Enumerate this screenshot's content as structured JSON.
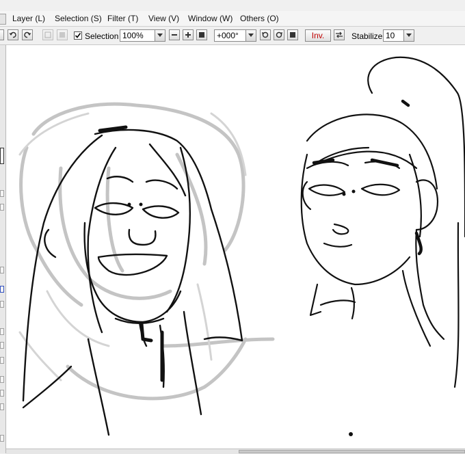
{
  "menu": {
    "items": [
      {
        "label": "Layer (L)"
      },
      {
        "label": "Selection (S)"
      },
      {
        "label": "Filter (T)"
      },
      {
        "label": "View (V)"
      },
      {
        "label": "Window (W)"
      },
      {
        "label": "Others (O)"
      }
    ]
  },
  "toolbar": {
    "undo_icon": "undo-icon",
    "redo_icon": "redo-icon",
    "selection_checkbox_checked": true,
    "selection_label": "Selection",
    "zoom_value": "100%",
    "rotation_value": "+000°",
    "invert_label": "Inv.",
    "stabilizer_label": "Stabilizer",
    "stabilizer_value": "10",
    "invert_color": "#c00000"
  },
  "canvas": {
    "background": "#ffffff",
    "content": "sketch of two characters"
  }
}
